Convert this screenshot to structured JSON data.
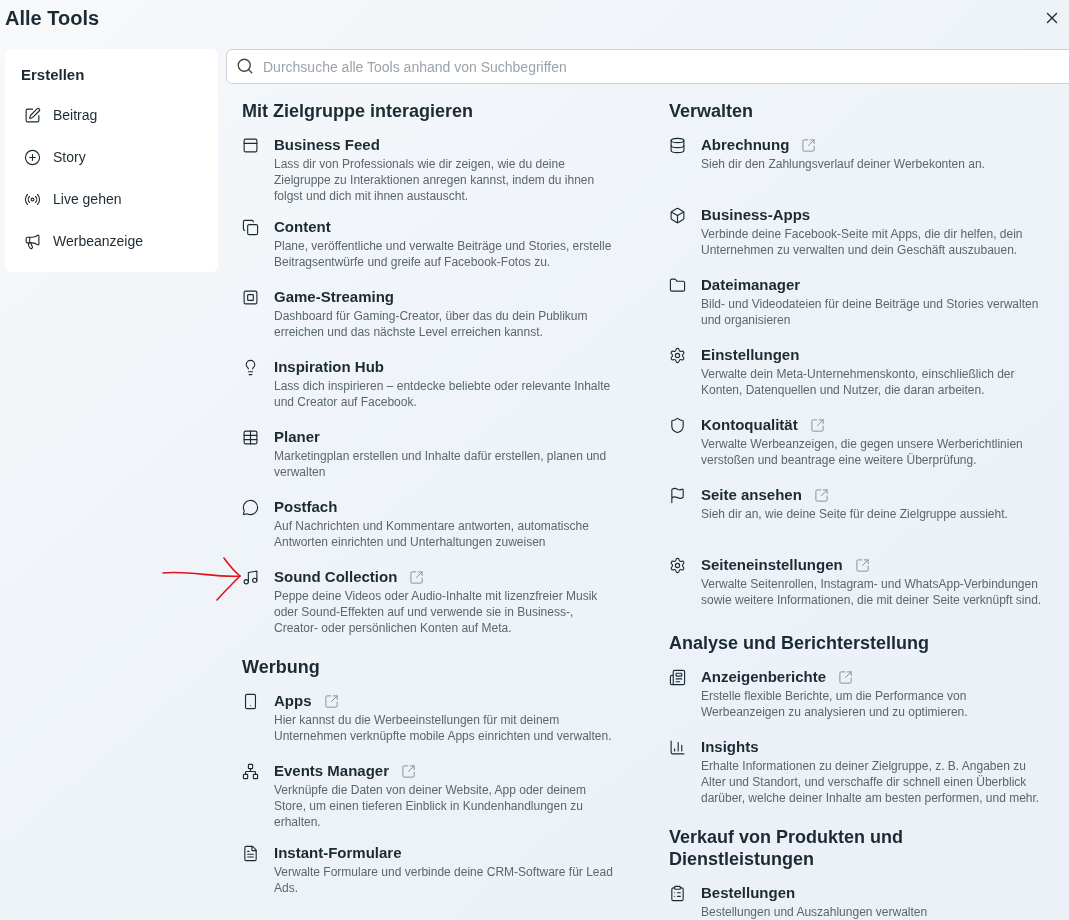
{
  "title": "Alle Tools",
  "sidebar": {
    "heading": "Erstellen",
    "items": [
      {
        "label": "Beitrag"
      },
      {
        "label": "Story"
      },
      {
        "label": "Live gehen"
      },
      {
        "label": "Werbeanzeige"
      }
    ]
  },
  "search": {
    "placeholder": "Durchsuche alle Tools anhand von Suchbegriffen"
  },
  "columns": [
    [
      {
        "heading": "Mit Zielgruppe interagieren",
        "items": [
          {
            "title": "Business Feed",
            "external": false,
            "description": "Lass dir von Professionals wie dir zeigen, wie du deine Zielgruppe zu Interaktionen anregen kannst, indem du ihnen folgst und dich mit ihnen austauscht."
          },
          {
            "title": "Content",
            "external": false,
            "description": "Plane, veröffentliche und verwalte Beiträge und Stories, erstelle Beitragsentwürfe und greife auf Facebook-Fotos zu."
          },
          {
            "title": "Game-Streaming",
            "external": false,
            "description": "Dashboard für Gaming-Creator, über das du dein Publikum erreichen und das nächste Level erreichen kannst."
          },
          {
            "title": "Inspiration Hub",
            "external": false,
            "description": "Lass dich inspirieren – entdecke beliebte oder relevante Inhalte und Creator auf Facebook."
          },
          {
            "title": "Planer",
            "external": false,
            "description": "Marketingplan erstellen und Inhalte dafür erstellen, planen und verwalten"
          },
          {
            "title": "Postfach",
            "external": false,
            "description": "Auf Nachrichten und Kommentare antworten, automatische Antworten einrichten und Unterhaltungen zuweisen"
          },
          {
            "title": "Sound Collection",
            "external": true,
            "description": "Peppe deine Videos oder Audio-Inhalte mit lizenzfreier Musik oder Sound-Effekten auf und verwende sie in Business-, Creator- oder persönlichen Konten auf Meta."
          }
        ]
      },
      {
        "heading": "Werbung",
        "items": [
          {
            "title": "Apps",
            "external": true,
            "description": "Hier kannst du die Werbeeinstellungen für mit deinem Unternehmen verknüpfte mobile Apps einrichten und verwalten."
          },
          {
            "title": "Events Manager",
            "external": true,
            "description": "Verknüpfe die Daten von deiner Website, App oder deinem Store, um einen tieferen Einblick in Kundenhandlungen zu erhalten."
          },
          {
            "title": "Instant-Formulare",
            "external": false,
            "description": "Verwalte Formulare und verbinde deine CRM-Software für Lead Ads."
          }
        ]
      }
    ],
    [
      {
        "heading": "Verwalten",
        "items": [
          {
            "title": "Abrechnung",
            "external": true,
            "description": "Sieh dir den Zahlungsverlauf deiner Werbekonten an."
          },
          {
            "title": "Business-Apps",
            "external": false,
            "description": "Verbinde deine Facebook-Seite mit Apps, die dir helfen, dein Unternehmen zu verwalten und dein Geschäft auszubauen."
          },
          {
            "title": "Dateimanager",
            "external": false,
            "description": "Bild- und Videodateien für deine Beiträge und Stories verwalten und organisieren"
          },
          {
            "title": "Einstellungen",
            "external": false,
            "description": "Verwalte dein Meta-Unternehmenskonto, einschließlich der Konten, Datenquellen und Nutzer, die daran arbeiten."
          },
          {
            "title": "Kontoqualität",
            "external": true,
            "description": "Verwalte Werbeanzeigen, die gegen unsere Werberichtlinien verstoßen und beantrage eine weitere Überprüfung."
          },
          {
            "title": "Seite ansehen",
            "external": true,
            "description": "Sieh dir an, wie deine Seite für deine Zielgruppe aussieht."
          },
          {
            "title": "Seiteneinstellungen",
            "external": true,
            "description": "Verwalte Seitenrollen, Instagram- und WhatsApp-Verbindungen sowie weitere Informationen, die mit deiner Seite verknüpft sind."
          }
        ]
      },
      {
        "heading": "Analyse und Berichterstellung",
        "items": [
          {
            "title": "Anzeigenberichte",
            "external": true,
            "description": "Erstelle flexible Berichte, um die Performance von Werbeanzeigen zu analysieren und zu optimieren."
          },
          {
            "title": "Insights",
            "external": false,
            "description": "Erhalte Informationen zu deiner Zielgruppe, z. B. Angaben zu Alter und Standort, und verschaffe dir schnell einen Überblick darüber, welche deiner Inhalte am besten performen, und mehr."
          }
        ]
      },
      {
        "heading": "Verkauf von Produkten und Dienstleistungen",
        "items": [
          {
            "title": "Bestellungen",
            "external": false,
            "description": "Bestellungen und Auszahlungen verwalten"
          }
        ]
      }
    ]
  ]
}
